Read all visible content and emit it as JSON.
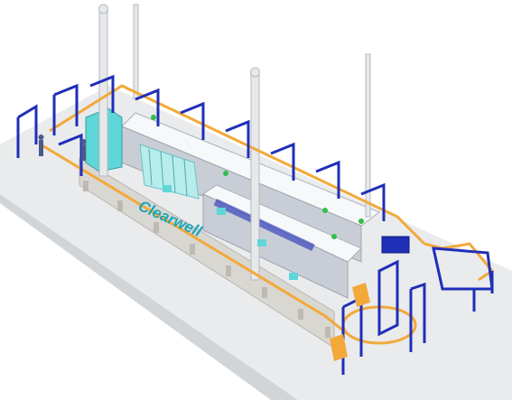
{
  "image": {
    "brand_label": "Clearwell",
    "colors": {
      "floor": "#e9ebed",
      "floor_edge": "#d2d5d8",
      "frame_blue": "#1f2fb8",
      "conveyor_orange": "#f2a93a",
      "booth_white": "#f7f8fa",
      "booth_shadow": "#c9ced6",
      "panel_grey": "#d9d7d2",
      "stack_grey": "#e6e8ea",
      "accent_green": "#2fbf4a",
      "accent_cyan": "#5fd6d8",
      "brand_teal": "#1aa7b8"
    }
  }
}
